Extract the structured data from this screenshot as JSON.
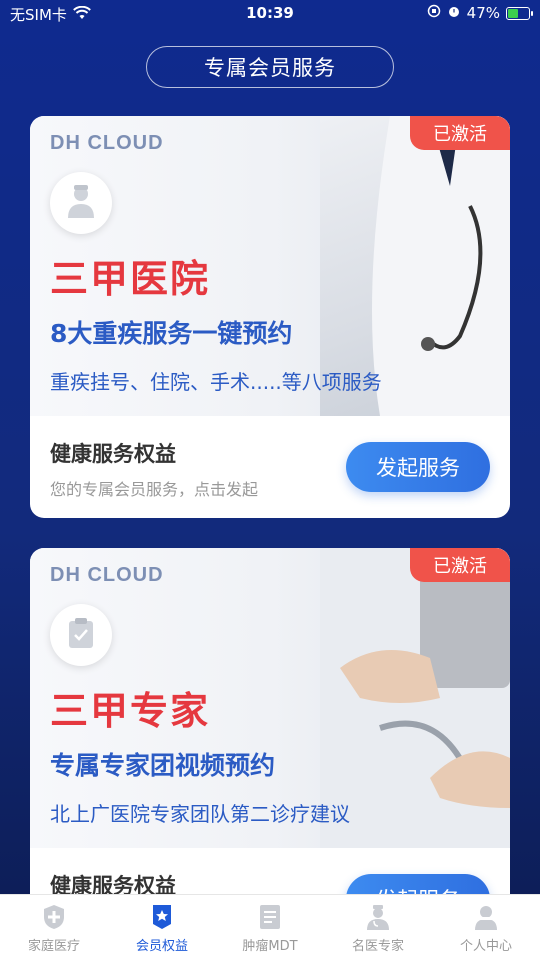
{
  "status_bar": {
    "carrier": "无SIM卡",
    "time": "10:39",
    "battery": "47%"
  },
  "header": {
    "title": "专属会员服务"
  },
  "cards": [
    {
      "brand": "DH CLOUD",
      "tag": "已激活",
      "title": "三甲医院",
      "subtitle": "8大重疾服务一键预约",
      "desc": "重疾挂号、住院、手术.....等八项服务",
      "footer_title": "健康服务权益",
      "footer_sub": "您的专属会员服务，点击发起",
      "button": "发起服务"
    },
    {
      "brand": "DH CLOUD",
      "tag": "已激活",
      "title": "三甲专家",
      "subtitle": "专属专家团视频预约",
      "desc": "北上广医院专家团队第二诊疗建议",
      "footer_title": "健康服务权益",
      "button": "发起服务"
    }
  ],
  "tabs": [
    {
      "label": "家庭医疗",
      "icon": "shield-plus-icon"
    },
    {
      "label": "会员权益",
      "icon": "star-badge-icon",
      "active": true
    },
    {
      "label": "肿瘤MDT",
      "icon": "document-icon"
    },
    {
      "label": "名医专家",
      "icon": "doctor-icon"
    },
    {
      "label": "个人中心",
      "icon": "person-icon"
    }
  ],
  "colors": {
    "accent": "#1e5ad8",
    "tag_red": "#f0534a",
    "title_red": "#e5383f",
    "text_blue": "#2b5bc4"
  }
}
